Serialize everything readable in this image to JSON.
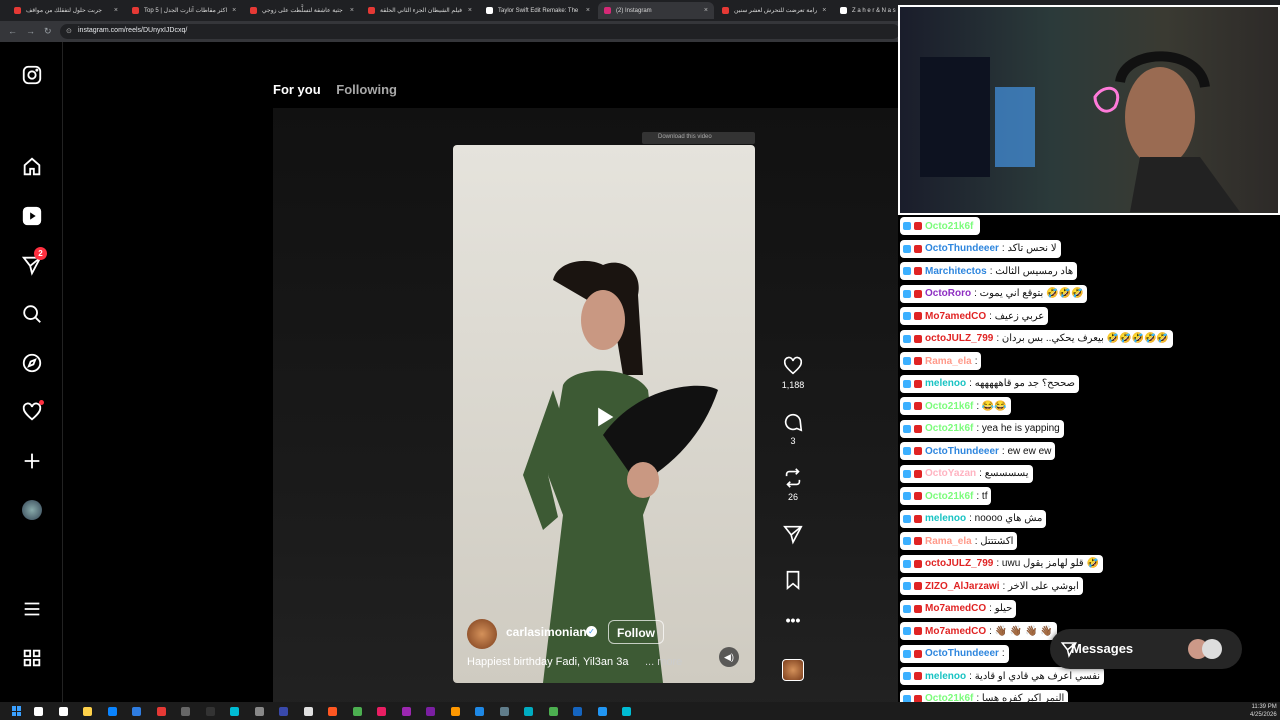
{
  "browser": {
    "tabs": [
      {
        "title": "جربت حلول لتفقلك من مواقف",
        "color": "#e53935"
      },
      {
        "title": "Top 5 | اكثر مقاطات آثارت الجدل",
        "color": "#e53935"
      },
      {
        "title": "جثية عاشقة لتسلَّطت على زوجي",
        "color": "#e53935"
      },
      {
        "title": "فيلم الشيطان الجزء الثاني الحلقة",
        "color": "#e53935"
      },
      {
        "title": "Taylor Swift Edit Remake: The",
        "color": "#ffffff"
      },
      {
        "title": "(2) Instagram",
        "color": "#d62976"
      },
      {
        "title": "رامة تعرضت للتحرش لعشر سنين",
        "color": "#e53935"
      },
      {
        "title": "Z a h e r & N a s",
        "color": "#ffffff"
      }
    ],
    "url": "instagram.com/reels/DUnyxIJDcxq/"
  },
  "instagram": {
    "nav": {
      "for_you": "For you",
      "following": "Following"
    },
    "notif_count": "2",
    "download_banner": "Download this video",
    "reel": {
      "username": "carlasimonian",
      "follow": "Follow",
      "caption": "Happiest birthday Fadi, Yil3an 3a",
      "more": "... more"
    },
    "actions": {
      "likes": "1,188",
      "comments": "3",
      "reposts": "26"
    }
  },
  "messages_label": "Messages",
  "chat": [
    {
      "user": "Octo21k6f",
      "text": "",
      "ucolor": "#7cfc7c"
    },
    {
      "user": "OctoThundeeer",
      "text": ": لا نحس تاكد",
      "ucolor": "#2e86de"
    },
    {
      "user": "Marchitectos",
      "text": ": هاد رمسيس الثالث",
      "ucolor": "#2e86de"
    },
    {
      "user": "OctoRoro",
      "text": ": بتوقع اني يموت 🤣🤣🤣",
      "ucolor": "#8e2ec2"
    },
    {
      "user": "Mo7amedCO",
      "text": ": عربي زعيف",
      "ucolor": "#e02424"
    },
    {
      "user": "octoJULZ_799",
      "text": ": بيعرف يحكي.. بس بردان 🤣🤣🤣🤣🤣",
      "ucolor": "#e02424"
    },
    {
      "user": "Rama_ela",
      "text": ":",
      "ucolor": "#ff9a8a"
    },
    {
      "user": "melenoo",
      "text": ": صححح؟ جد مو قاهههههه",
      "ucolor": "#19c3c3"
    },
    {
      "user": "Octo21k6f",
      "text": ": 😂😂",
      "ucolor": "#7cfc7c"
    },
    {
      "user": "Octo21k6f",
      "text": ": yea he is yapping",
      "ucolor": "#7cfc7c"
    },
    {
      "user": "OctoThundeeer",
      "text": ": ew ew ew",
      "ucolor": "#2e86de"
    },
    {
      "user": "OctoYazan",
      "text": ": يسسسسع",
      "ucolor": "#ffb3c1"
    },
    {
      "user": "Octo21k6f",
      "text": ": tf",
      "ucolor": "#7cfc7c"
    },
    {
      "user": "melenoo",
      "text": ": noooo مش هاي",
      "ucolor": "#19c3c3"
    },
    {
      "user": "Rama_ela",
      "text": ": اكشتتتل",
      "ucolor": "#ff9a8a"
    },
    {
      "user": "octoJULZ_799",
      "text": ": uwu قلو لهامز يقول 🤣",
      "ucolor": "#e02424"
    },
    {
      "user": "ZIZO_AlJarzawi",
      "text": ": ابوشي على الاخر",
      "ucolor": "#e02424"
    },
    {
      "user": "Mo7amedCO",
      "text": ": حيلو",
      "ucolor": "#e02424"
    },
    {
      "user": "Mo7amedCO",
      "text": ": 👋🏾 👋🏾 👋🏾 👋🏾",
      "ucolor": "#e02424"
    },
    {
      "user": "OctoThundeeer",
      "text": ":",
      "ucolor": "#2e86de"
    },
    {
      "user": "melenoo",
      "text": ": نفسي اعرف هي قادي او قادية",
      "ucolor": "#19c3c3"
    },
    {
      "user": "Octo21k6f",
      "text": ": النمر اكبر كفره هسا",
      "ucolor": "#7cfc7c"
    }
  ],
  "clock": {
    "time": "11:39 PM",
    "date": "4/25/2026"
  }
}
